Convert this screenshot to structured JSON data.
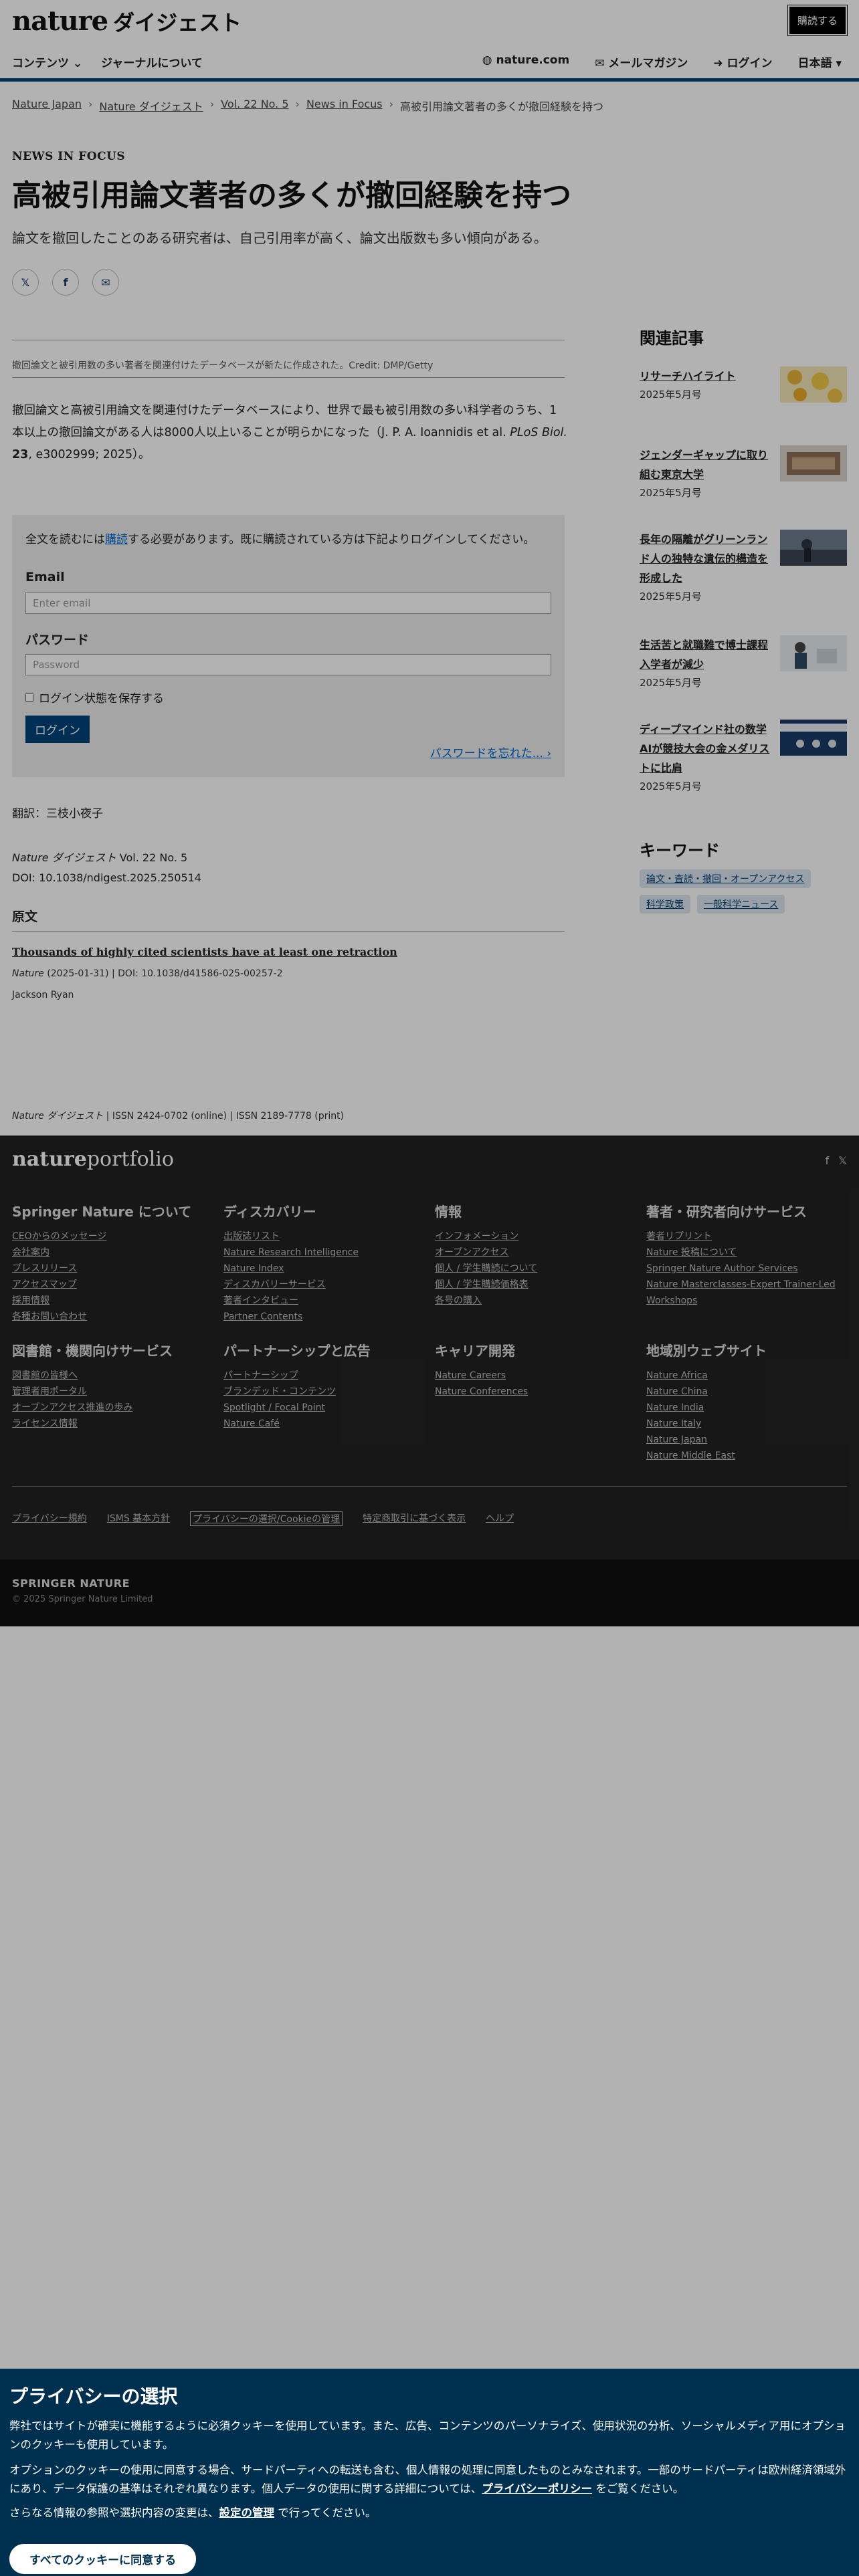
{
  "header": {
    "logo_main": "nature",
    "logo_sub": "ダイジェスト",
    "subscribe": "購読する",
    "nav_left": [
      "コンテンツ ⌄",
      "ジャーナルについて"
    ],
    "nav_right": [
      "◍ nature.com",
      "✉ メールマガジン",
      "➜ ログイン",
      "日本語 ▾"
    ]
  },
  "breadcrumb": [
    "Nature Japan",
    "Nature ダイジェスト",
    "Vol. 22 No. 5",
    "News in Focus",
    "高被引用論文著者の多くが撤回経験を持つ"
  ],
  "article": {
    "kicker": "NEWS IN FOCUS",
    "title": "高被引用論文著者の多くが撤回経験を持つ",
    "standfirst": "論文を撤回したことのある研究者は、自己引用率が高く、論文出版数も多い傾向がある。",
    "caption": "撤回論文と被引用数の多い著者を関連付けたデータベースが新たに作成された。Credit: DMP/Getty",
    "body_1": "撤回論文と高被引用論文を関連付けたデータベースにより、世界で最も被引用数の多い科学者のうち、1本以上の撤回論文がある人は8000人以上いることが明らかになった（J. P. A. Ioannidis et al.",
    "body_journal": "PLoS Biol.",
    "body_vol": "23",
    "body_2": ", e3002999; 2025）。",
    "translator": "翻訳：三枝小夜子",
    "citation_journal": "Nature ダイジェスト",
    "citation_vol": " Vol. 22 No. 5",
    "doi": "DOI: 10.1038/ndigest.2025.250514",
    "orig_heading": "原文",
    "orig_title": "Thousands of highly cited scientists have at least one retraction",
    "orig_journal": "Nature",
    "orig_meta": " (2025-01-31) | DOI: 10.1038/d41586-025-00257-2",
    "orig_author": "Jackson Ryan",
    "issn_journal": "Nature ダイジェスト",
    "issn": " | ISSN 2424-0702 (online) | ISSN 2189-7778 (print)"
  },
  "login": {
    "msg_before": "全文を読むには",
    "msg_link": "購読",
    "msg_after": "する必要があります。既に購読されている方は下記よりログインしてください。",
    "email_label": "Email",
    "email_placeholder": "Enter email",
    "password_label": "パスワード",
    "password_placeholder": "Password",
    "remember": "ログイン状態を保存する",
    "button": "ログイン",
    "forgot": "パスワードを忘れた... ›"
  },
  "sidebar": {
    "related_heading": "関連記事",
    "related": [
      {
        "title": "リサーチハイライト",
        "date": "2025年5月号"
      },
      {
        "title": "ジェンダーギャップに取り組む東京大学",
        "date": "2025年5月号"
      },
      {
        "title": "長年の隔離がグリーンランド人の独特な遺伝的構造を形成した",
        "date": "2025年5月号"
      },
      {
        "title": "生活苦と就職難で博士課程入学者が減少",
        "date": "2025年5月号"
      },
      {
        "title": "ディープマインド社の数学AIが競技大会の金メダリストに比肩",
        "date": "2025年5月号"
      }
    ],
    "keywords_heading": "キーワード",
    "keywords": [
      "論文・査読・撤回・オープンアクセス",
      "科学政策",
      "一般科学ニュース"
    ]
  },
  "footer": {
    "logo_a": "nature",
    "logo_b": "portfolio",
    "social": [
      "f",
      "𝕏"
    ],
    "columns": [
      {
        "heading": "Springer Nature について",
        "links": [
          "CEOからのメッセージ",
          "会社案内",
          "プレスリリース",
          "アクセスマップ",
          "採用情報",
          "各種お問い合わせ"
        ]
      },
      {
        "heading": "ディスカバリー",
        "links": [
          "出版誌リスト",
          "Nature Research Intelligence",
          "Nature Index",
          "ディスカバリーサービス",
          "著者インタビュー",
          "Partner Contents"
        ]
      },
      {
        "heading": "情報",
        "links": [
          "インフォメーション",
          "オープンアクセス",
          "個人 / 学生購読について",
          "個人 / 学生購読価格表",
          "各号の購入"
        ]
      },
      {
        "heading": "著者・研究者向けサービス",
        "links": [
          "著者リプリント",
          "Nature 投稿について",
          "Springer Nature Author Services",
          "Nature Masterclasses-Expert Trainer-Led",
          "Workshops"
        ]
      },
      {
        "heading": "図書館・機関向けサービス",
        "links": [
          "図書館の皆様へ",
          "管理者用ポータル",
          "オープンアクセス推進の歩み",
          "ライセンス情報"
        ]
      },
      {
        "heading": "パートナーシップと広告",
        "links": [
          "パートナーシップ",
          "ブランデッド・コンテンツ",
          "Spotlight / Focal Point",
          "Nature Café"
        ]
      },
      {
        "heading": "キャリア開発",
        "links": [
          "Nature Careers",
          "Nature Conferences"
        ]
      },
      {
        "heading": "地域別ウェブサイト",
        "links": [
          "Nature Africa",
          "Nature China",
          "Nature India",
          "Nature Italy",
          "Nature Japan",
          "Nature Middle East"
        ]
      }
    ],
    "legal": [
      "プライバシー規約",
      "ISMS 基本方針",
      "プライバシーの選択/Cookieの管理",
      "特定商取引に基づく表示",
      "ヘルプ"
    ],
    "sn_logo": "SPRINGER NATURE",
    "copyright": "© 2025 Springer Nature Limited"
  },
  "privacy": {
    "heading": "プライバシーの選択",
    "p1": "弊社ではサイトが確実に機能するように必須クッキーを使用しています。また、広告、コンテンツのパーソナライズ、使用状況の分析、ソーシャルメディア用にオプションのクッキーも使用しています。",
    "p2_before": "オプションのクッキーの使用に同意する場合、サードパーティへの転送も含む、個人情報の処理に同意したものとみなされます。一部のサードパーティは欧州経済領域外にあり、データ保護の基準はそれぞれ異なります。個人データの使用に関する詳細については、",
    "p2_link": "プライバシーポリシー",
    "p2_after": " をご覧ください。",
    "p3_before": "さらなる情報の参照や選択内容の変更は、",
    "p3_link": "設定の管理",
    "p3_after": " で行ってください。",
    "accept": "すべてのクッキーに同意する"
  }
}
